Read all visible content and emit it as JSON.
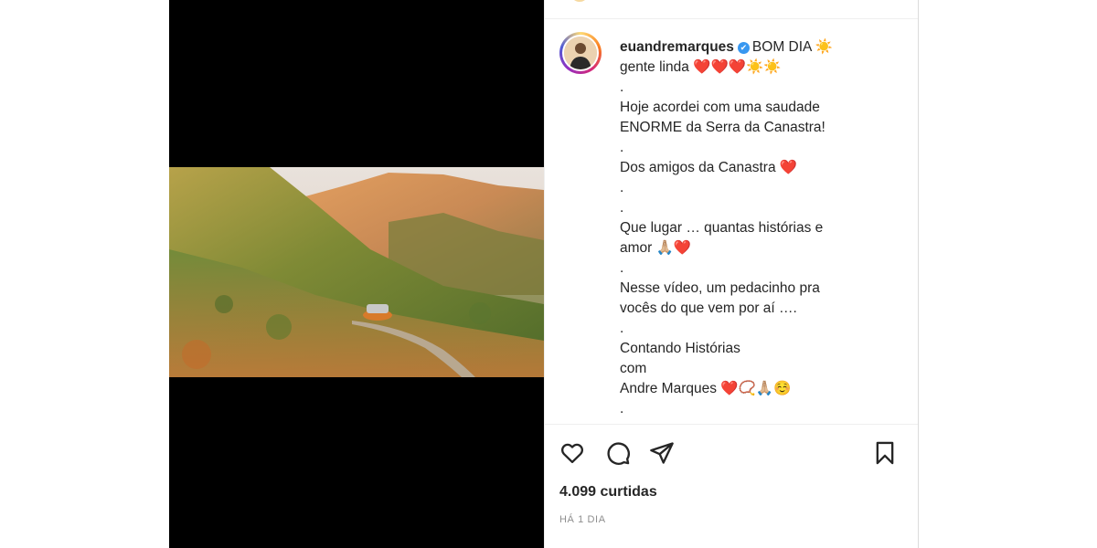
{
  "post": {
    "username": "euandremarques",
    "caption_lines": [
      "BOM DIA ☀️",
      "gente linda ❤️❤️❤️☀️☀️",
      ".",
      "Hoje acordei com uma saudade",
      "ENORME da Serra da Canastra!",
      ".",
      "Dos amigos da Canastra ❤️",
      ".",
      ".",
      "Que lugar … quantas histórias e",
      "amor 🙏🏼❤️",
      ".",
      "Nesse vídeo, um pedacinho pra",
      "vocês do que vem por aí ….",
      ".",
      "Contando Histórias",
      "com",
      "Andre Marques ❤️📿🙏🏼☺️",
      "."
    ],
    "likes": "4.099 curtidas",
    "time_ago": "HÁ 1 DIA"
  },
  "icons": {
    "like": "heart-icon",
    "comment": "comment-icon",
    "share": "send-icon",
    "save": "bookmark-icon",
    "verified": "verified-badge-icon"
  },
  "colors": {
    "verified": "#3897f0",
    "text": "#262626",
    "muted": "#8e8e8e"
  }
}
